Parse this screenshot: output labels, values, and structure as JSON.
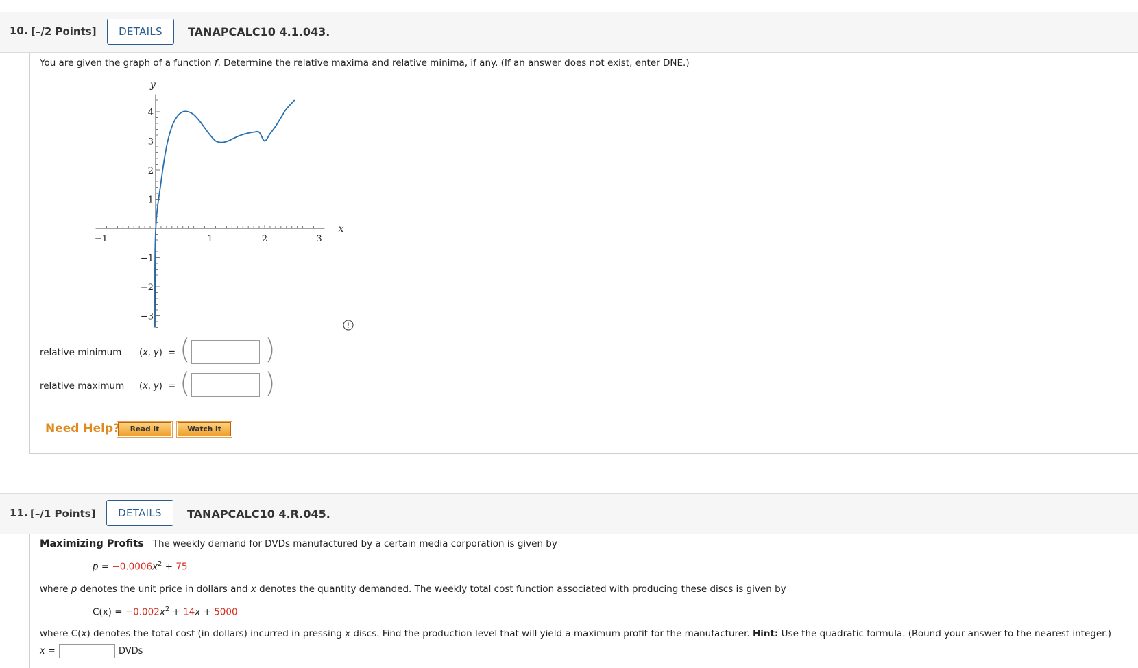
{
  "q10": {
    "number": "10.",
    "points": "[–/2 Points]",
    "details_label": "DETAILS",
    "code": "TANAPCALC10 4.1.043.",
    "prompt_pre": "You are given the graph of a function ",
    "prompt_f": "f",
    "prompt_post": ". Determine the relative maxima and relative minima, if any. (If an answer does not exist, enter DNE.)",
    "rel_min_label": "relative minimum",
    "rel_max_label": "relative maximum",
    "xy_label": "(x, y)  =",
    "rel_min_value": "",
    "rel_max_value": "",
    "need_help": "Need Help?",
    "read_it": "Read It",
    "watch_it": "Watch It",
    "info_icon": "info-icon"
  },
  "q11": {
    "number": "11.",
    "points": "[–/1 Points]",
    "details_label": "DETAILS",
    "code": "TANAPCALC10 4.R.045.",
    "title": "Maximizing Profits",
    "intro": "The weekly demand for DVDs manufactured by a certain media corporation is given by",
    "p_eq_lhs": "p = ",
    "p_coef": "−0.0006",
    "p_x": "x",
    "p_exp": "2",
    "p_plus": " + ",
    "p_const": "75",
    "where1_a": "where ",
    "where1_p": "p",
    "where1_b": " denotes the unit price in dollars and ",
    "where1_x": "x",
    "where1_c": " denotes the quantity demanded. The weekly total cost function associated with producing these discs is given by",
    "c_lhs": "C(x) = ",
    "c_coef": "−0.002",
    "c_x": "x",
    "c_exp": "2",
    "c_plus1": " + ",
    "c_lin": "14",
    "c_x2": "x",
    "c_plus2": " + ",
    "c_const": "5000",
    "where2_a": "where C(",
    "where2_x": "x",
    "where2_b": ") denotes the total cost (in dollars) incurred in pressing ",
    "where2_x2": "x",
    "where2_c": " discs. Find the production level that will yield a maximum profit for the manufacturer. ",
    "hint_label": "Hint:",
    "where2_d": " Use the quadratic formula. (Round your answer to the nearest integer.)",
    "answer_label": "x = ",
    "answer_value": "",
    "answer_unit": "DVDs"
  },
  "chart_data": {
    "type": "line",
    "xlabel": "x",
    "ylabel": "y",
    "xlim": [
      -1,
      3
    ],
    "ylim": [
      -3,
      4.5
    ],
    "x_ticks": [
      -1,
      1,
      2,
      3
    ],
    "y_ticks": [
      -3,
      -2,
      -1,
      1,
      2,
      3,
      4
    ],
    "x_tick_labels": [
      "−1",
      "1",
      "2",
      "3"
    ],
    "y_tick_labels": [
      "−3",
      "−2",
      "−1",
      "1",
      "2",
      "3",
      "4"
    ],
    "grid": false,
    "series": [
      {
        "color": "#2a6fb0",
        "x": [
          -0.02,
          0.0,
          0.1,
          0.2,
          0.3,
          0.4,
          0.5,
          0.6,
          0.7,
          0.8,
          0.9,
          1.0,
          1.1,
          1.2,
          1.3,
          1.4,
          1.5,
          1.6,
          1.7,
          1.8,
          1.9,
          2.0,
          2.1,
          2.2,
          2.3,
          2.4,
          2.55
        ],
        "y": [
          -3.4,
          -0.1,
          1.6,
          2.8,
          3.5,
          3.85,
          4.0,
          4.0,
          3.9,
          3.7,
          3.45,
          3.2,
          3.0,
          2.95,
          2.98,
          3.06,
          3.15,
          3.22,
          3.27,
          3.3,
          3.3,
          3.0,
          3.25,
          3.5,
          3.8,
          4.1,
          4.4
        ]
      }
    ]
  }
}
